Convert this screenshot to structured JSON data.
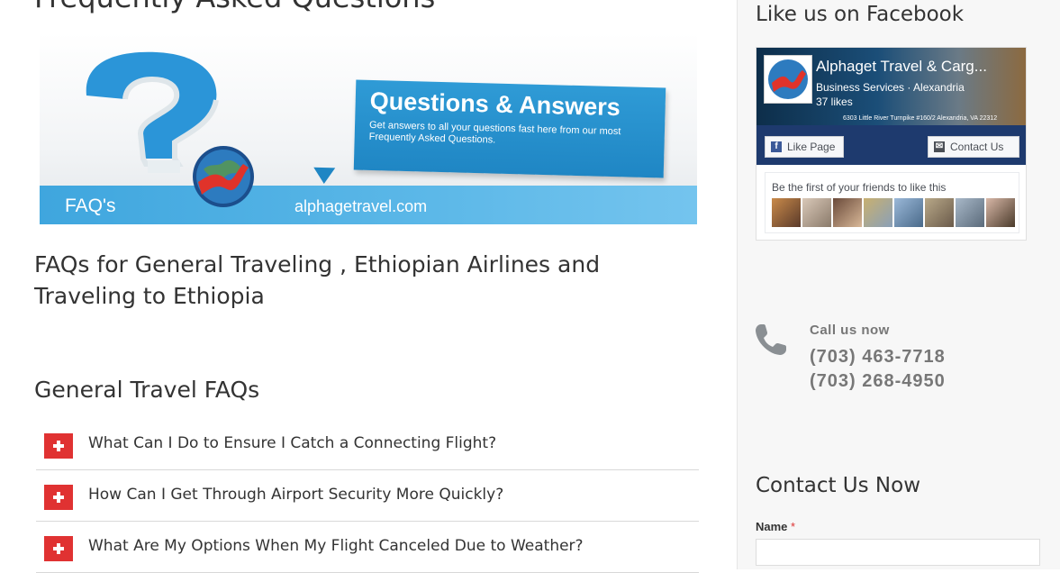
{
  "main": {
    "page_title": "Frequently Asked Questions",
    "banner": {
      "bubble_title": "Questions & Answers",
      "bubble_text": "Get answers to all your questions fast here from our most Frequently Asked Questions.",
      "faq_label": "FAQ's",
      "site": "alphagetravel.com"
    },
    "intro_heading": "FAQs for General Traveling , Ethiopian Airlines and Traveling to Ethiopia",
    "section_heading": "General Travel FAQs",
    "faqs": [
      {
        "question": "What Can I Do to Ensure I Catch a Connecting Flight?"
      },
      {
        "question": "How Can I Get Through Airport Security More Quickly?"
      },
      {
        "question": "What Are My Options When My Flight Canceled Due to Weather?"
      }
    ]
  },
  "sidebar": {
    "facebook_title": "Like us on Facebook",
    "fb": {
      "page_name": "Alphaget Travel & Carg...",
      "category": "Business Services · Alexandria",
      "likes": "37 likes",
      "address": "6303 Little River Turnpike #160/2 Alexandria, VA 22312",
      "like_button": "Like Page",
      "contact_button": "Contact Us",
      "friends_text": "Be the first of your friends to like this"
    },
    "call": {
      "label": "Call us now",
      "phone1": "(703) 463-7718",
      "phone2": "(703) 268-4950"
    },
    "contact_title": "Contact Us Now",
    "form": {
      "name_label": "Name",
      "required_mark": "*"
    }
  },
  "colors": {
    "faq_plus": "#e03232",
    "banner_blue": "#3fa6de",
    "fb_blue": "#1e3a6e"
  }
}
